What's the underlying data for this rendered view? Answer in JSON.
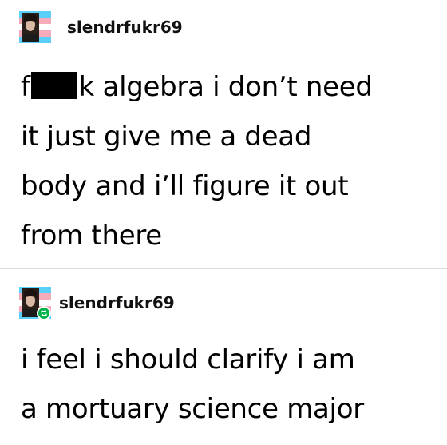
{
  "posts": [
    {
      "username": "slendrfukr69",
      "lines": [
        {
          "before_censor": "f",
          "censor": "█",
          "after_censor": "k algebra i don’t need"
        },
        {
          "text": "it just give me a dead"
        },
        {
          "text": "body and i’ll figure it out"
        },
        {
          "text": "from there"
        }
      ]
    },
    {
      "username": "slendrfukr69",
      "lines": [
        {
          "text": "i feel i should clarify i am"
        },
        {
          "text": "a mortuary science major"
        }
      ]
    }
  ],
  "colors": {
    "reblog_badge": "#00b24a",
    "flag_blue": "#5bcffa",
    "flag_pink": "#f5abb9",
    "divider": "#dcdcdc"
  },
  "icons": {
    "avatar": "avatar-image",
    "reblog": "reblog-icon"
  }
}
